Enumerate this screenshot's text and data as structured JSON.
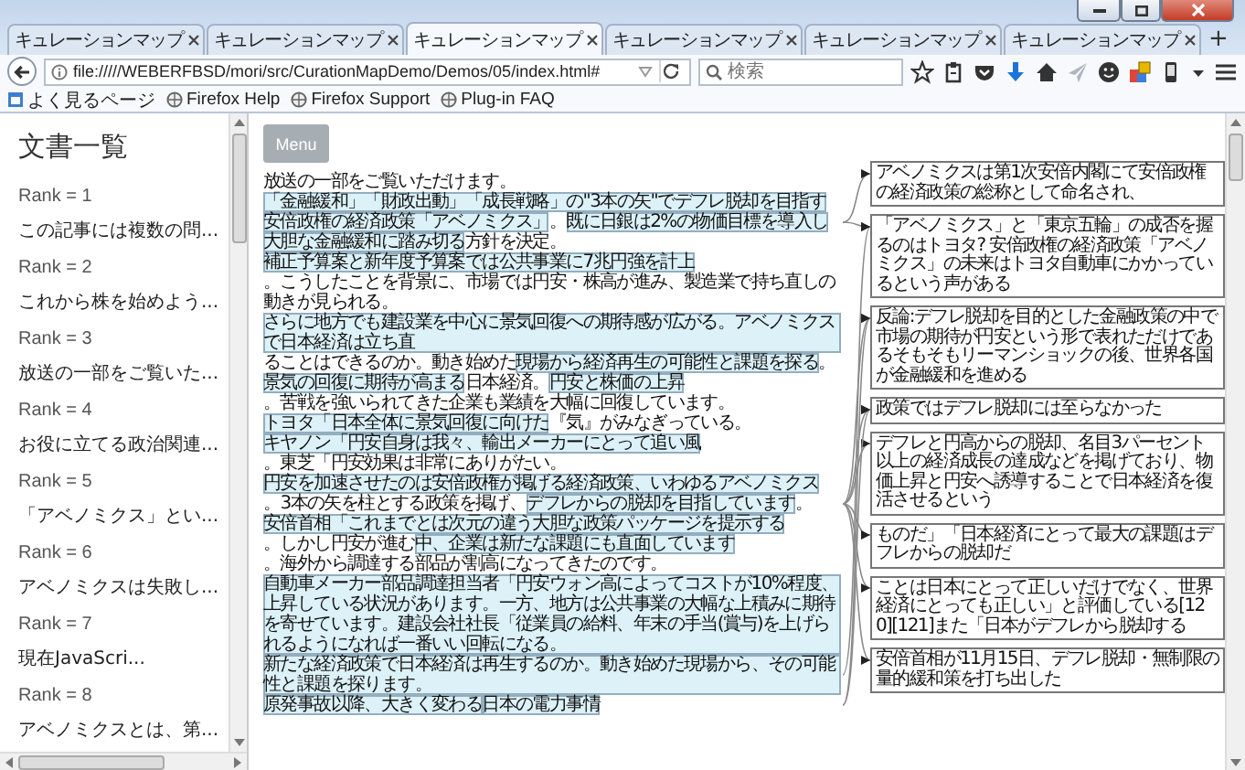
{
  "browser": {
    "tabs": [
      {
        "title": "キュレーションマップ",
        "selected": false
      },
      {
        "title": "キュレーションマップ",
        "selected": false
      },
      {
        "title": "キュレーションマップ",
        "selected": true
      },
      {
        "title": "キュレーションマップ",
        "selected": false
      },
      {
        "title": "キュレーションマップ",
        "selected": false
      },
      {
        "title": "キュレーションマップ",
        "selected": false
      }
    ],
    "new_tab": "+",
    "address": "file://///WEBERFBSD/mori/src/CurationMapDemo/Demos/05/index.html#",
    "search": {
      "placeholder": "検索"
    },
    "bookmarks": [
      "よく見るページ",
      "Firefox Help",
      "Firefox Support",
      "Plug-in FAQ"
    ]
  },
  "sidebar": {
    "title": "文書一覧",
    "documents": [
      {
        "rank": "Rank = 1",
        "title": "この記事には複数の問..."
      },
      {
        "rank": "Rank = 2",
        "title": "これから株を始めよう..."
      },
      {
        "rank": "Rank = 3",
        "title": "放送の一部をご覧いた..."
      },
      {
        "rank": "Rank = 4",
        "title": "お役に立てる政治関連..."
      },
      {
        "rank": "Rank = 5",
        "title": "「アベノミクス」とい..."
      },
      {
        "rank": "Rank = 6",
        "title": "アベノミクスは失敗し..."
      },
      {
        "rank": "Rank = 7",
        "title": "現在JavaScri..."
      },
      {
        "rank": "Rank = 8",
        "title": "アベノミクスとは、第..."
      }
    ]
  },
  "menu_button": "Menu",
  "passage": [
    {
      "text": "放送の一部をご覧いただけます。",
      "highlighted": false
    },
    {
      "text": "「金融緩和」「財政出動」「成長戦略」の\"3本の矢\"でデフレ脱却を目指す",
      "highlighted": true
    },
    {
      "text": "安倍政権の経済政策「アベノミクス」",
      "highlighted": true
    },
    {
      "text": "。",
      "highlighted": false
    },
    {
      "text": "既に日銀は2%の物価目標を導入し",
      "highlighted": true
    },
    {
      "text": "大胆な金融緩和に踏み切る",
      "highlighted": true
    },
    {
      "text": "方針を決定。",
      "highlighted": false
    },
    {
      "text": "補正予算案と新年度予算案では公共事業に7兆円強を計上",
      "highlighted": true
    },
    {
      "text": "。こうしたことを背景に、市場では円安・株高が進み、製造業で持ち直しの動きが見られる。",
      "highlighted": false
    },
    {
      "text": "さらに地方でも建設業を中心に景気回復への期待感が広がる。アベノミクスで日本経済は立ち直",
      "highlighted": true
    },
    {
      "text": "ることはできるのか。動き始めた",
      "highlighted": false
    },
    {
      "text": "現場から経済再生の可能性と課題を探る",
      "highlighted": true
    },
    {
      "text": "。",
      "highlighted": false
    },
    {
      "text": "景気の回復に期待が高まる",
      "highlighted": true
    },
    {
      "text": "日本経済。",
      "highlighted": false
    },
    {
      "text": "円安と株価の上昇",
      "highlighted": true
    },
    {
      "text": "。苦戦を強いられてきた企業も業績を大幅に回復しています。",
      "highlighted": false
    },
    {
      "text": "トヨタ「日本全体に景気回復に向けた",
      "highlighted": true
    },
    {
      "text": "『気』がみなぎっている。",
      "highlighted": false
    },
    {
      "text": "キヤノン「円安自身は我々、輸出メーカーにとって追い風",
      "highlighted": true
    },
    {
      "text": "。東芝「円安効果は非常にありがたい。",
      "highlighted": false
    },
    {
      "text": "円安を加速させたのは安倍政権が掲げる経済政策、いわゆるアベノミクス",
      "highlighted": true
    },
    {
      "text": "。3本の矢を柱とする政策を掲げ、",
      "highlighted": false
    },
    {
      "text": "デフレからの脱却を目指しています",
      "highlighted": true
    },
    {
      "text": "。",
      "highlighted": false
    },
    {
      "text": "安倍首相「これまでとは次元の違う大胆な政策パッケージを提示する",
      "highlighted": true
    },
    {
      "text": "。しかし円安が進む",
      "highlighted": false
    },
    {
      "text": "中、企業は新たな課題にも直面しています",
      "highlighted": true
    },
    {
      "text": "。海外から調達する部品が割高になってきたのです。",
      "highlighted": false
    },
    {
      "text": "自動車メーカー部品調達担当者「円安ウォン高によってコストが10%程度、上昇している状況があります。一方、地方は公共事業の大幅な上積みに期待を寄せています。建設会社社長「従業員の給料、年末の手当(賞与)を上げられるようになれば一番いい回転になる。",
      "highlighted": true
    },
    {
      "text": "新たな経済政策で日本経済は再生するのか。動き始めた現場から、その可能性と課題を探ります。",
      "highlighted": true
    },
    {
      "text": "原発事故以降、大きく変わる",
      "highlighted": true
    },
    {
      "text": "日本の電力事情",
      "highlighted": true
    }
  ],
  "notes": [
    "アベノミクスは第1次安倍内閣にて安倍政権の経済政策の総称として命名され、",
    "「アベノミクス」と「東京五輪」の成否を握るのはトヨタ? 安倍政権の経済政策「アベノミクス」の未来はトヨタ自動車にかかっているという声がある",
    "反論:デフレ脱却を目的とした金融政策の中で市場の期待が円安という形で表れただけであるそもそもリーマンショックの後、世界各国が金融緩和を進める",
    "政策ではデフレ脱却には至らなかった",
    "デフレと円高からの脱却、名目3パーセント以上の経済成長の達成などを掲げており、物価上昇と円安へ誘導することで日本経済を復活させるという",
    "ものだ」「日本経済にとって最大の課題はデフレからの脱却だ",
    "ことは日本にとって正しいだけでなく、世界経済にとっても正しい」と評価している[120][121]また「日本がデフレから脱却する",
    "安倍首相が11月15日、デフレ脱却・無制限の量的緩和策を打ち出した"
  ]
}
